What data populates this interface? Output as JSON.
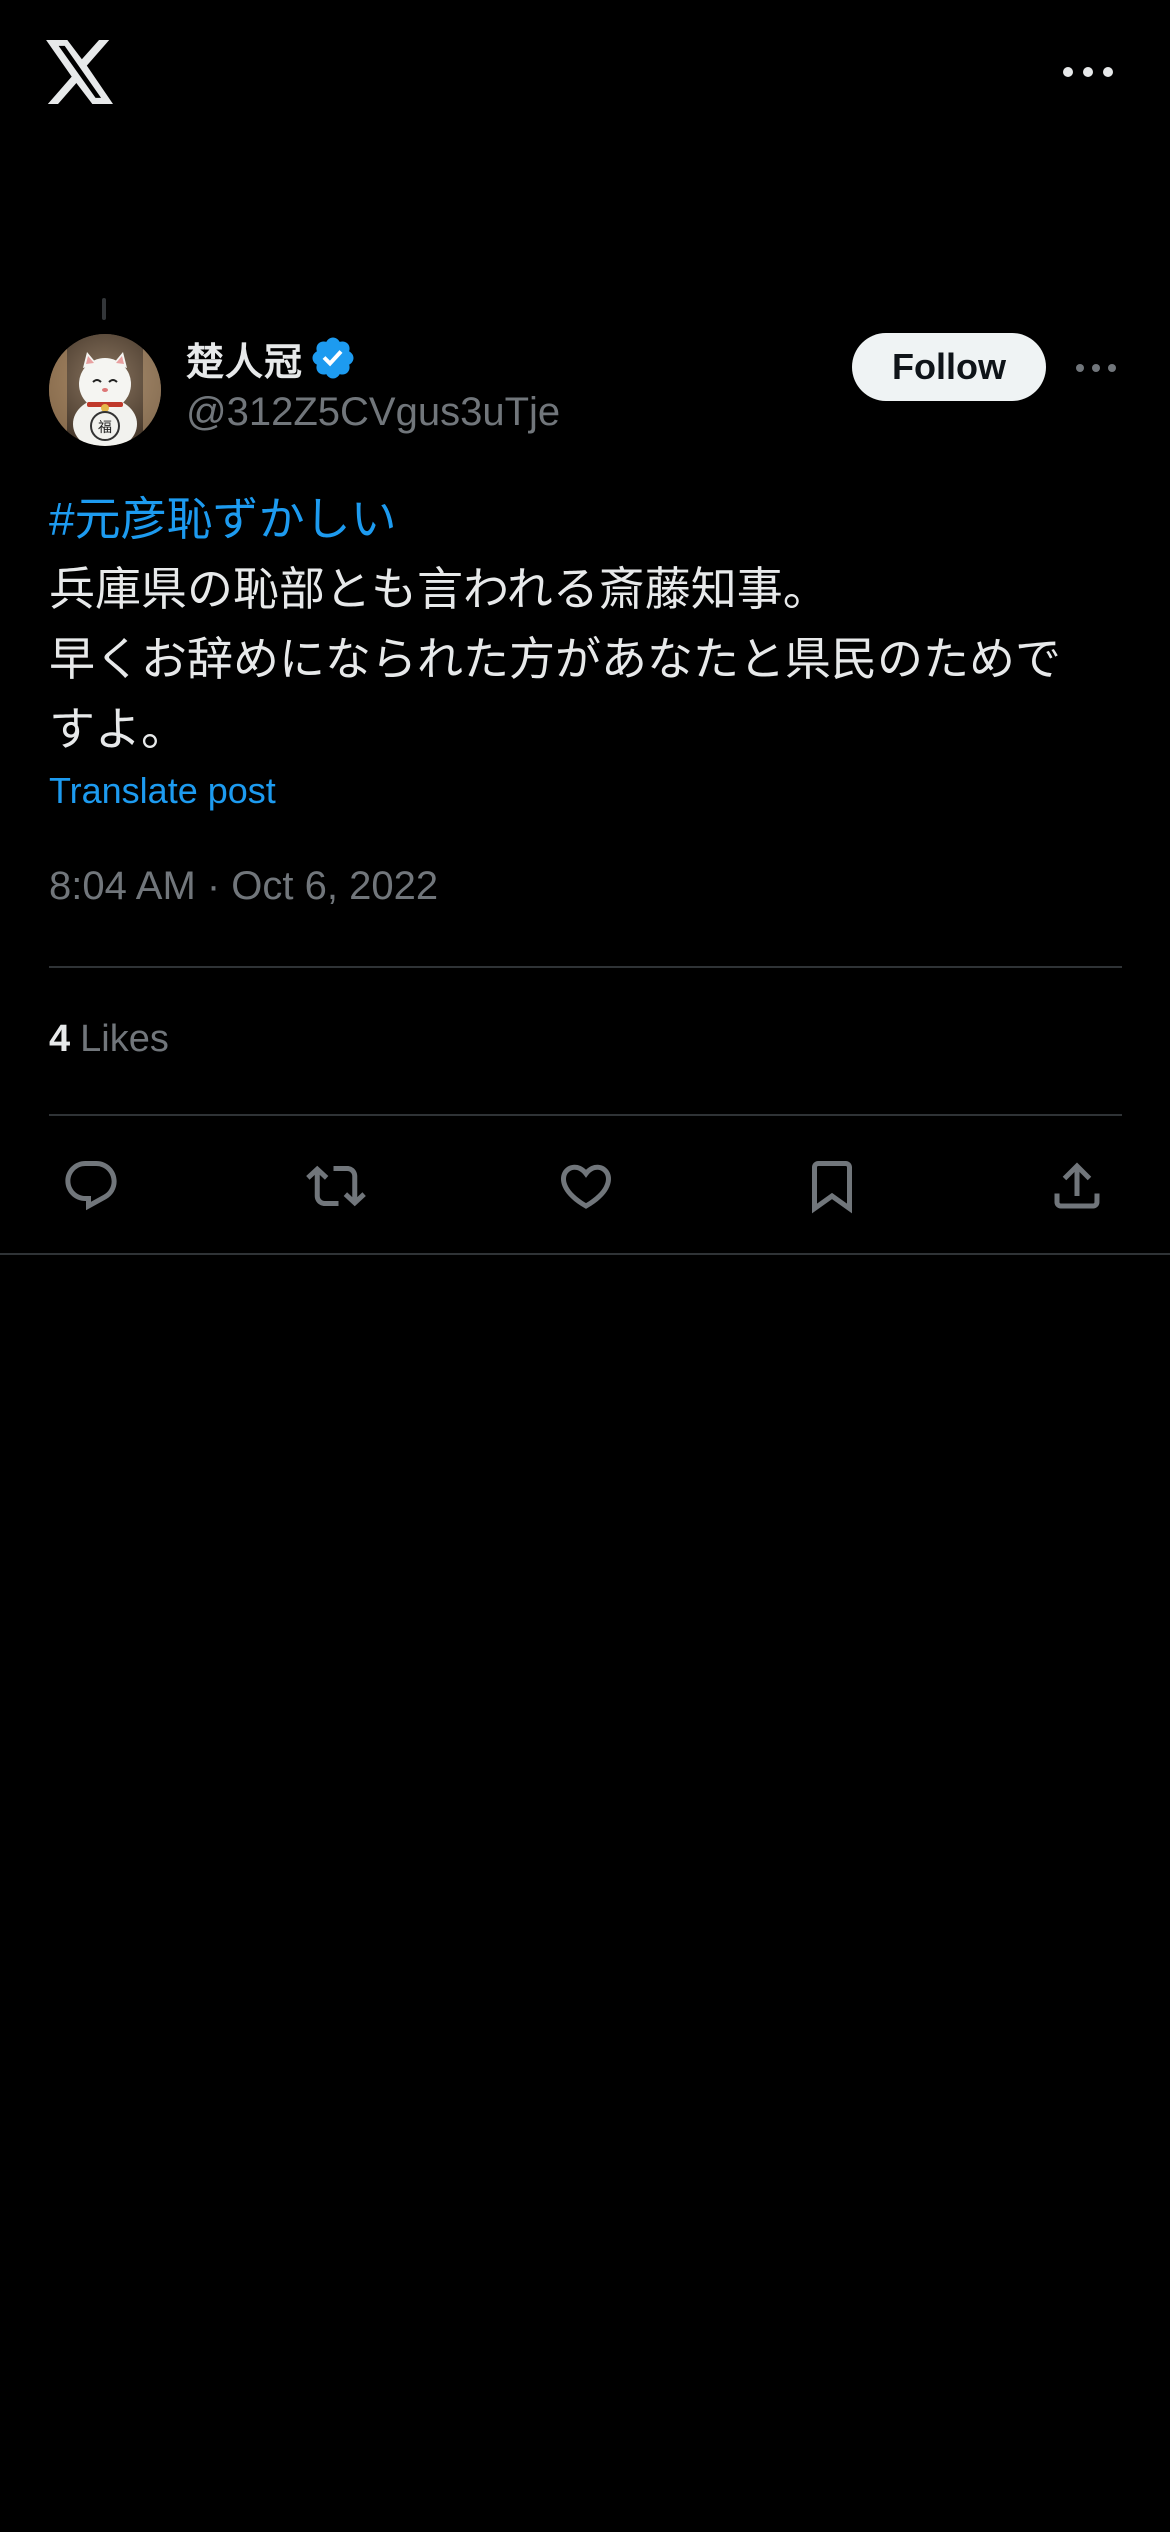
{
  "header": {
    "logo_icon": "x-logo-icon",
    "menu_icon": "more-horizontal-icon"
  },
  "post": {
    "author": {
      "display_name": "楚人冠",
      "handle": "@312Z5CVgus3uTje",
      "verified": true
    },
    "follow_label": "Follow",
    "hashtag": "#元彦恥ずかしい",
    "lines": [
      "兵庫県の恥部とも言われる斎藤知事。",
      "早くお辞めになられた方があなたと県民のためで",
      "すよ。"
    ],
    "translate_label": "Translate post",
    "timestamp": "8:04 AM · Oct 6, 2022",
    "likes": {
      "count": "4",
      "label": "Likes"
    }
  },
  "actions": [
    {
      "name": "reply",
      "icon": "reply-icon"
    },
    {
      "name": "repost",
      "icon": "repost-icon"
    },
    {
      "name": "like",
      "icon": "heart-icon"
    },
    {
      "name": "bookmark",
      "icon": "bookmark-icon"
    },
    {
      "name": "share",
      "icon": "share-icon"
    }
  ],
  "colors": {
    "background": "#000000",
    "accent": "#1d9bf0",
    "text": "#e7e9ea",
    "muted": "#71767b",
    "divider": "#2f3336"
  }
}
